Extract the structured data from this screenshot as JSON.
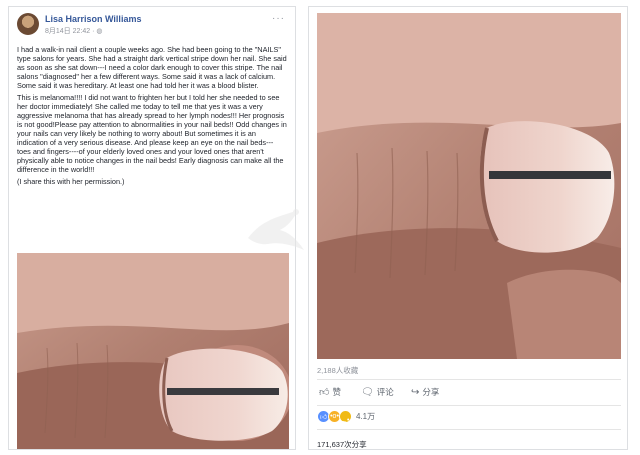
{
  "post": {
    "author": "Lisa Harrison Williams",
    "timestamp": "8月14日 22:42",
    "privacy_icon": "globe-icon",
    "more_label": "···",
    "paragraphs": [
      "I had a walk-in nail client a couple weeks ago. She had been going to the \"NAILS\" type salons for years. She had a straight dark vertical stripe down her nail. She said as soon as she sat down---I need a color dark enough to cover this stripe. The nail salons \"diagnosed\" her a few different ways. Some said it was a lack of calcium. Some said it was hereditary. At least one had told her it was a blood blister.",
      "This is melanoma!!!! I did not want to frighten her but I told her she needed to see her doctor immediately! She called me today to tell me that yes it was a very aggressive melanoma that has already spread to her lymph nodes!!! Her prognosis is not good!Please pay attention to abnormalities in your nail beds!! Odd changes in your nails can very likely be nothing to worry about! But sometimes it is an indication of a very serious disease. And please keep an eye on the nail beds---toes and fingers----of your elderly loved ones and your loved ones that aren't physically able to notice changes in the nail beds! Early diagnosis can make all the difference in the world!!!",
      "(I share this with her permission.)"
    ]
  },
  "stats": {
    "saved": "2,188人收藏",
    "reaction_count": "4.1万",
    "shares": "171,637次分享"
  },
  "actions": {
    "like": "赞",
    "comment": "评论",
    "share": "分享"
  },
  "colors": {
    "author_link": "#365899",
    "meta_gray": "#90949c",
    "like_blue": "#5890ff"
  }
}
